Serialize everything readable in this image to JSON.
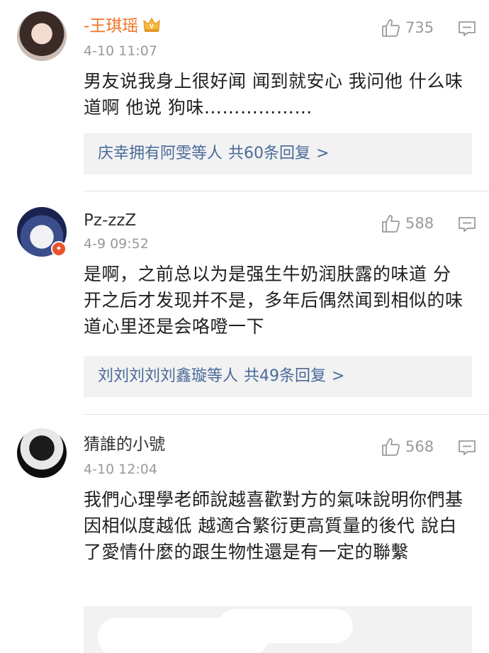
{
  "comments": [
    {
      "username": "-王琪瑶",
      "time": "4-10 11:07",
      "likes": "735",
      "content": "男友说我身上很好闻 闻到就安心 我问他 什么味道啊 他说 狗味………………",
      "replies": {
        "users": "庆幸拥有阿雯等人",
        "count": "共60条回复",
        "arrow": ">"
      }
    },
    {
      "username": "Pz-zzZ",
      "time": "4-9 09:52",
      "likes": "588",
      "content": "是啊，之前总以为是强生牛奶润肤露的味道 分开之后才发现并不是，多年后偶然闻到相似的味道心里还是会咯噔一下",
      "replies": {
        "users": "刘刘刘刘刘鑫璇等人",
        "count": "共49条回复",
        "arrow": ">"
      }
    },
    {
      "username": "猜誰的小號",
      "time": "4-10 12:04",
      "likes": "568",
      "content": "我們心理學老師說越喜歡對方的氣味說明你們基因相似度越低 越適合繁衍更高質量的後代 說白了愛情什麼的跟生物性還是有一定的聯繫"
    }
  ],
  "colors": {
    "vip_name": "#f07427",
    "link": "#4a6a9a",
    "muted": "#999999"
  },
  "icons": [
    "thumbs-up-icon",
    "reply-bubble-icon",
    "crown-icon",
    "verified-badge-icon"
  ]
}
